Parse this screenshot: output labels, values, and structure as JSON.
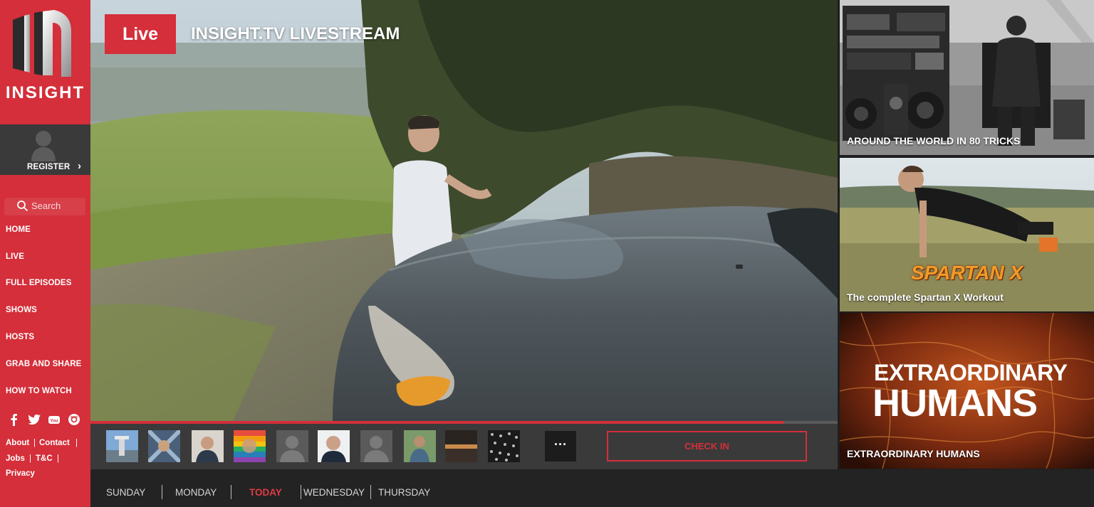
{
  "brand": {
    "name": "INSIGHT",
    "primary_color": "#d42f3a"
  },
  "sidebar": {
    "register_label": "REGISTER",
    "search_placeholder": "Search",
    "nav": [
      {
        "label": "HOME"
      },
      {
        "label": "LIVE"
      },
      {
        "label": "FULL EPISODES"
      },
      {
        "label": "SHOWS"
      },
      {
        "label": "HOSTS"
      },
      {
        "label": "GRAB AND SHARE"
      },
      {
        "label": "HOW TO WATCH"
      }
    ],
    "social": [
      "facebook-icon",
      "twitter-icon",
      "youtube-icon",
      "instagram-icon"
    ],
    "footer_links": {
      "about": "About",
      "contact": "Contact",
      "jobs": "Jobs",
      "tc": "T&C",
      "privacy": "Privacy",
      "separator": "|"
    }
  },
  "player": {
    "live_label": "Live",
    "title": "INSIGHT.TV LIVESTREAM",
    "progress": 0.928
  },
  "viewers": {
    "more_label": "···",
    "check_in_label": "CHECK IN"
  },
  "schedule": {
    "days": [
      "SUNDAY",
      "MONDAY",
      "TODAY",
      "WEDNESDAY",
      "THURSDAY"
    ],
    "active": "TODAY"
  },
  "promos": [
    {
      "caption": "AROUND THE WORLD IN 80 TRICKS"
    },
    {
      "caption": "The complete Spartan X Workout",
      "logo_text": "SPARTAN X"
    },
    {
      "caption": "EXTRAORDINARY HUMANS",
      "headline_line1": "EXTRAORDINARY",
      "headline_line2": "HUMANS"
    }
  ]
}
